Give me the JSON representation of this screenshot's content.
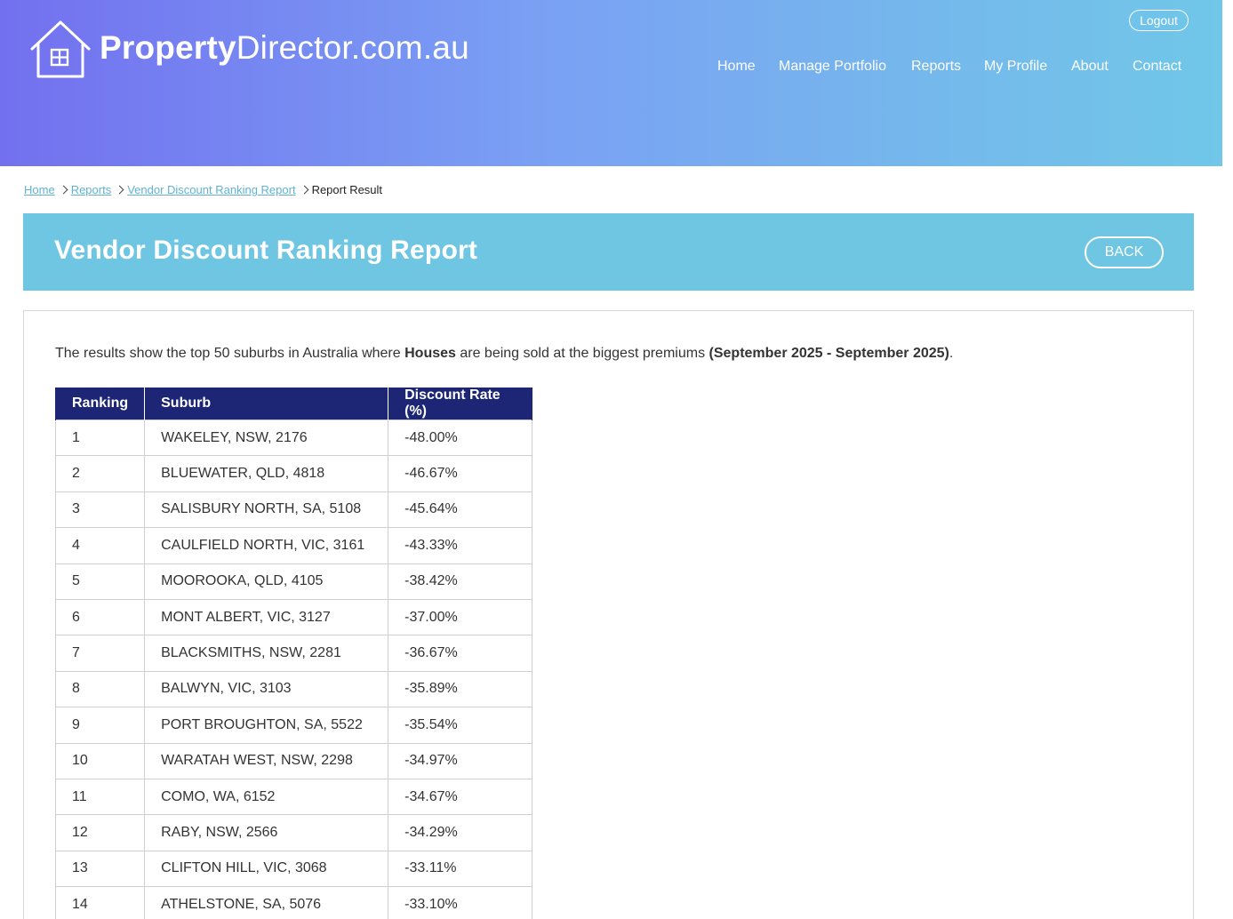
{
  "header": {
    "logo_bold": "Property",
    "logo_rest": "Director.com.au",
    "logout_label": "Logout",
    "nav": [
      {
        "label": "Home"
      },
      {
        "label": "Manage Portfolio"
      },
      {
        "label": "Reports"
      },
      {
        "label": "My Profile"
      },
      {
        "label": "About"
      },
      {
        "label": "Contact"
      }
    ]
  },
  "breadcrumb": {
    "items": [
      "Home",
      "Reports",
      "Vendor Discount Ranking Report"
    ],
    "current": "Report Result"
  },
  "page": {
    "title": "Vendor Discount Ranking Report",
    "back_label": "BACK"
  },
  "intro": {
    "prefix": "The results show the top 50 suburbs in Australia where ",
    "property_type": "Houses",
    "middle": " are being sold at the biggest premiums ",
    "period": "(September 2025 - September 2025)",
    "suffix": "."
  },
  "table": {
    "headers": [
      "Ranking",
      "Suburb",
      "Discount Rate (%)"
    ],
    "rows": [
      [
        "1",
        "WAKELEY, NSW, 2176",
        "-48.00%"
      ],
      [
        "2",
        "BLUEWATER, QLD, 4818",
        "-46.67%"
      ],
      [
        "3",
        "SALISBURY NORTH, SA, 5108",
        "-45.64%"
      ],
      [
        "4",
        "CAULFIELD NORTH, VIC, 3161",
        "-43.33%"
      ],
      [
        "5",
        "MOOROOKA, QLD, 4105",
        "-38.42%"
      ],
      [
        "6",
        "MONT ALBERT, VIC, 3127",
        "-37.00%"
      ],
      [
        "7",
        "BLACKSMITHS, NSW, 2281",
        "-36.67%"
      ],
      [
        "8",
        "BALWYN, VIC, 3103",
        "-35.89%"
      ],
      [
        "9",
        "PORT BROUGHTON, SA, 5522",
        "-35.54%"
      ],
      [
        "10",
        "WARATAH WEST, NSW, 2298",
        "-34.97%"
      ],
      [
        "11",
        "COMO, WA, 6152",
        "-34.67%"
      ],
      [
        "12",
        "RABY, NSW, 2566",
        "-34.29%"
      ],
      [
        "13",
        "CLIFTON HILL, VIC, 3068",
        "-33.11%"
      ],
      [
        "14",
        "ATHELSTONE, SA, 5076",
        "-33.10%"
      ]
    ]
  },
  "colors": {
    "banner": "#6fc6e2",
    "table_header": "#1c2674",
    "link": "#5fb3d6"
  }
}
